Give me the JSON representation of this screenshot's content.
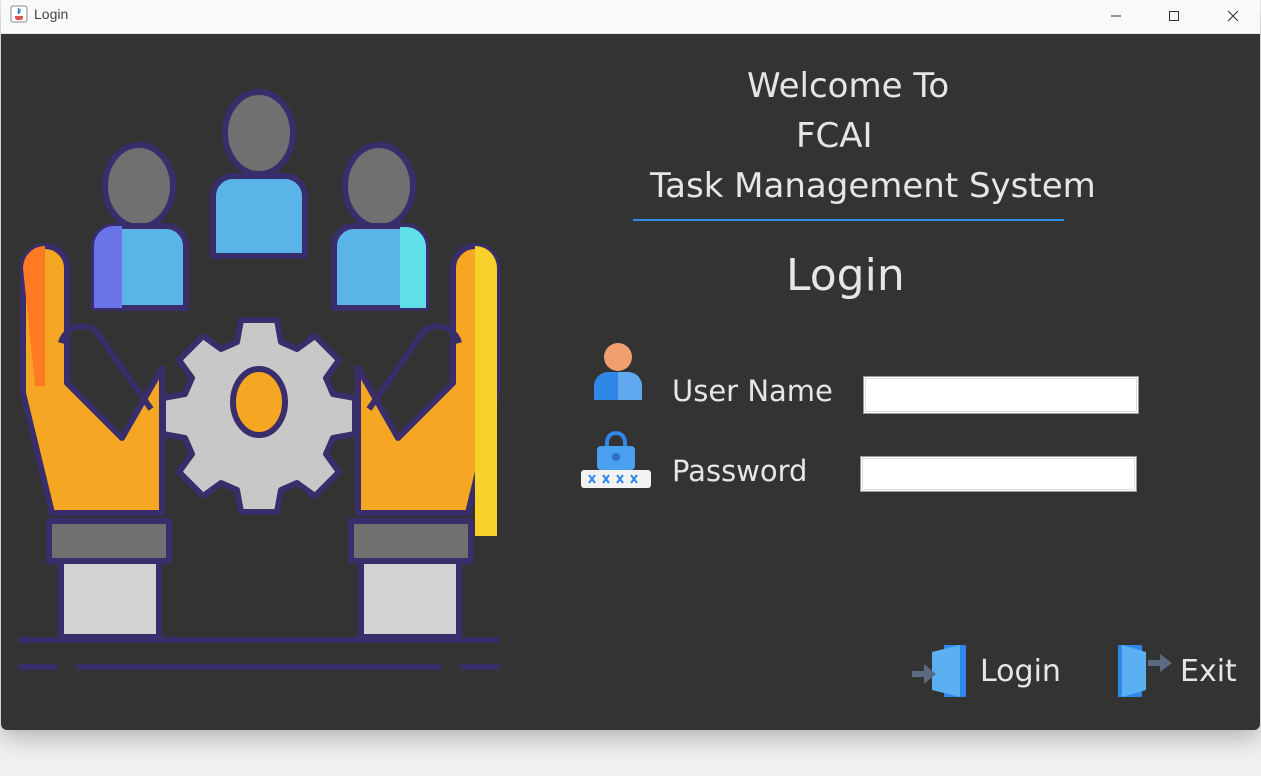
{
  "window": {
    "title": "Login"
  },
  "header": {
    "line1": "Welcome To",
    "line2": "FCAI",
    "line3": "Task Management System"
  },
  "form": {
    "heading": "Login",
    "username_label": "User Name",
    "username_value": "",
    "password_label": "Password",
    "password_value": ""
  },
  "actions": {
    "login_label": "Login",
    "exit_label": "Exit"
  },
  "colors": {
    "background": "#333333",
    "accent": "#2e8ee3",
    "text": "#e6e6e6"
  }
}
